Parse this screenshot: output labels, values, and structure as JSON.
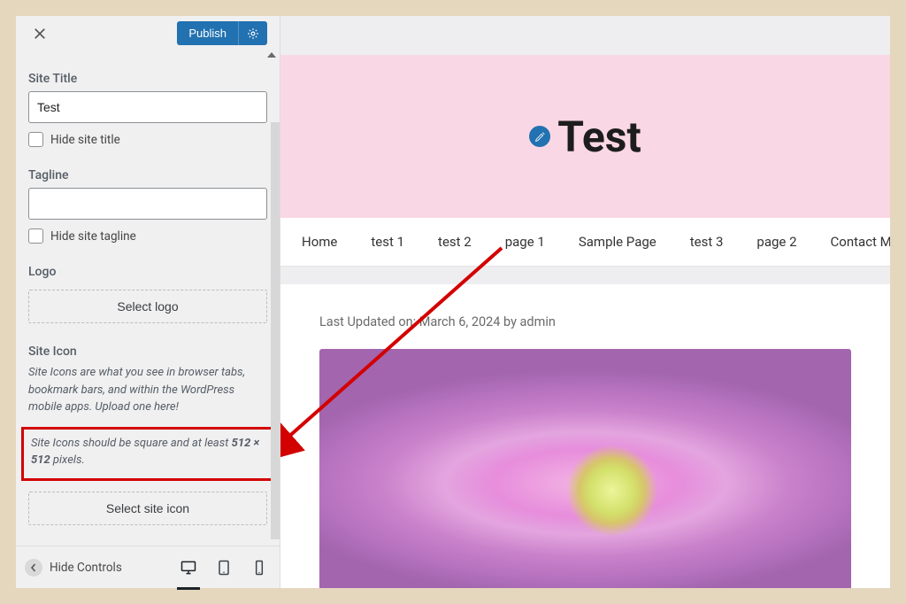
{
  "sidebar": {
    "publish_label": "Publish",
    "site_title_label": "Site Title",
    "site_title_value": "Test",
    "hide_site_title_label": "Hide site title",
    "tagline_label": "Tagline",
    "tagline_value": "",
    "hide_site_tagline_label": "Hide site tagline",
    "logo_label": "Logo",
    "select_logo_label": "Select logo",
    "site_icon_label": "Site Icon",
    "site_icon_desc1": "Site Icons are what you see in browser tabs, bookmark bars, and within the WordPress mobile apps. Upload one here!",
    "site_icon_desc2_pre": "Site Icons should be square and at least ",
    "site_icon_desc2_bold": "512 × 512",
    "site_icon_desc2_post": " pixels.",
    "select_site_icon_label": "Select site icon",
    "hide_controls_label": "Hide Controls"
  },
  "preview": {
    "site_title": "Test",
    "nav": [
      "Home",
      "test 1",
      "test 2",
      "page 1",
      "Sample Page",
      "test 3",
      "page 2",
      "Contact M"
    ],
    "last_updated": "Last Updated on: March 6, 2024 by admin"
  }
}
